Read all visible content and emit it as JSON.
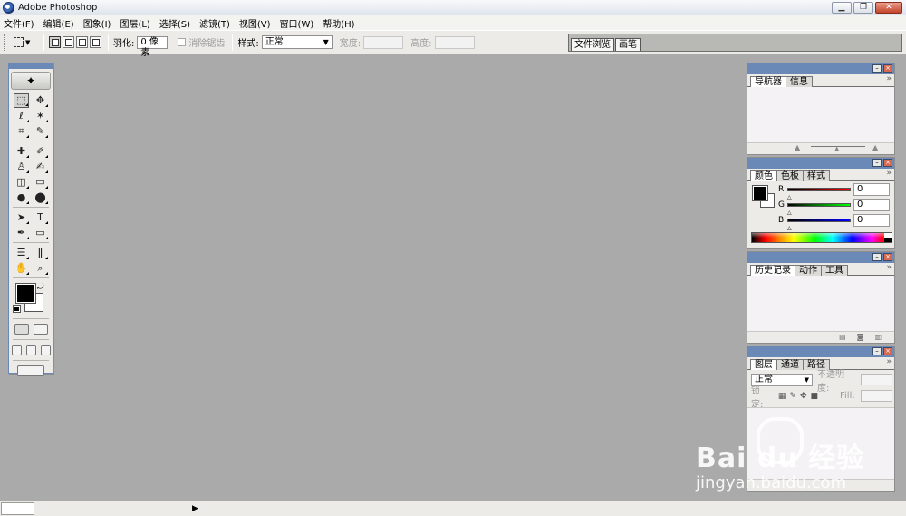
{
  "app": {
    "title": "Adobe Photoshop",
    "icon": "photoshop-app-icon"
  },
  "window_controls": {
    "minimize": "▁",
    "restore": "❐",
    "close": "✕"
  },
  "menus": [
    {
      "label": "文件(F)"
    },
    {
      "label": "编辑(E)"
    },
    {
      "label": "图象(I)"
    },
    {
      "label": "图层(L)"
    },
    {
      "label": "选择(S)"
    },
    {
      "label": "滤镜(T)"
    },
    {
      "label": "视图(V)"
    },
    {
      "label": "窗口(W)"
    },
    {
      "label": "帮助(H)"
    }
  ],
  "options": {
    "feather_label": "羽化:",
    "feather_value": "0 像素",
    "antialias_label": "消除锯齿",
    "style_label": "样式:",
    "style_value": "正常",
    "width_label": "宽度:",
    "height_label": "高度:"
  },
  "palette_well": {
    "tabs": [
      "文件浏览",
      "画笔"
    ]
  },
  "toolbox": {
    "logo": "✦",
    "tools": [
      [
        "marquee",
        "move"
      ],
      [
        "lasso",
        "magic-wand"
      ],
      [
        "crop",
        "slice"
      ],
      [
        "healing-brush",
        "brush"
      ],
      [
        "clone-stamp",
        "history-brush"
      ],
      [
        "eraser",
        "gradient"
      ],
      [
        "blur",
        "dodge"
      ],
      [
        "path-selection",
        "type"
      ],
      [
        "pen",
        "shape"
      ],
      [
        "notes",
        "eyedropper"
      ],
      [
        "hand",
        "zoom"
      ]
    ],
    "glyphs": {
      "marquee": "⬚",
      "move": "✥",
      "lasso": "ℓ",
      "magic-wand": "✶",
      "crop": "⌗",
      "slice": "✎",
      "healing-brush": "✚",
      "brush": "✐",
      "clone-stamp": "♙",
      "history-brush": "✍",
      "eraser": "◫",
      "gradient": "▭",
      "blur": "●",
      "dodge": "⬤",
      "path-selection": "➤",
      "type": "T",
      "pen": "✒",
      "shape": "▭",
      "notes": "☰",
      "eyedropper": "ǁ",
      "hand": "✋",
      "zoom": "⌕"
    },
    "foreground_color": "#000000",
    "background_color": "#ffffff"
  },
  "panels": {
    "navigator": {
      "tabs": [
        "导航器",
        "信息"
      ],
      "active": 0
    },
    "color": {
      "tabs": [
        "颜色",
        "色板",
        "样式"
      ],
      "active": 0,
      "channels": [
        {
          "name": "R",
          "value": "0",
          "color": "#cc0000"
        },
        {
          "name": "G",
          "value": "0",
          "color": "#00aa00"
        },
        {
          "name": "B",
          "value": "0",
          "color": "#0000cc"
        }
      ]
    },
    "history": {
      "tabs": [
        "历史记录",
        "动作",
        "工具"
      ],
      "active": 0
    },
    "layers": {
      "tabs": [
        "图层",
        "通道",
        "路径"
      ],
      "active": 0,
      "blend_mode": "正常",
      "opacity_label": "不透明度:",
      "lock_label": "锁定:",
      "fill_label": "Fill:"
    }
  },
  "watermark": {
    "brand": "Bai du 经验",
    "url": "jingyan.baidu.com"
  }
}
